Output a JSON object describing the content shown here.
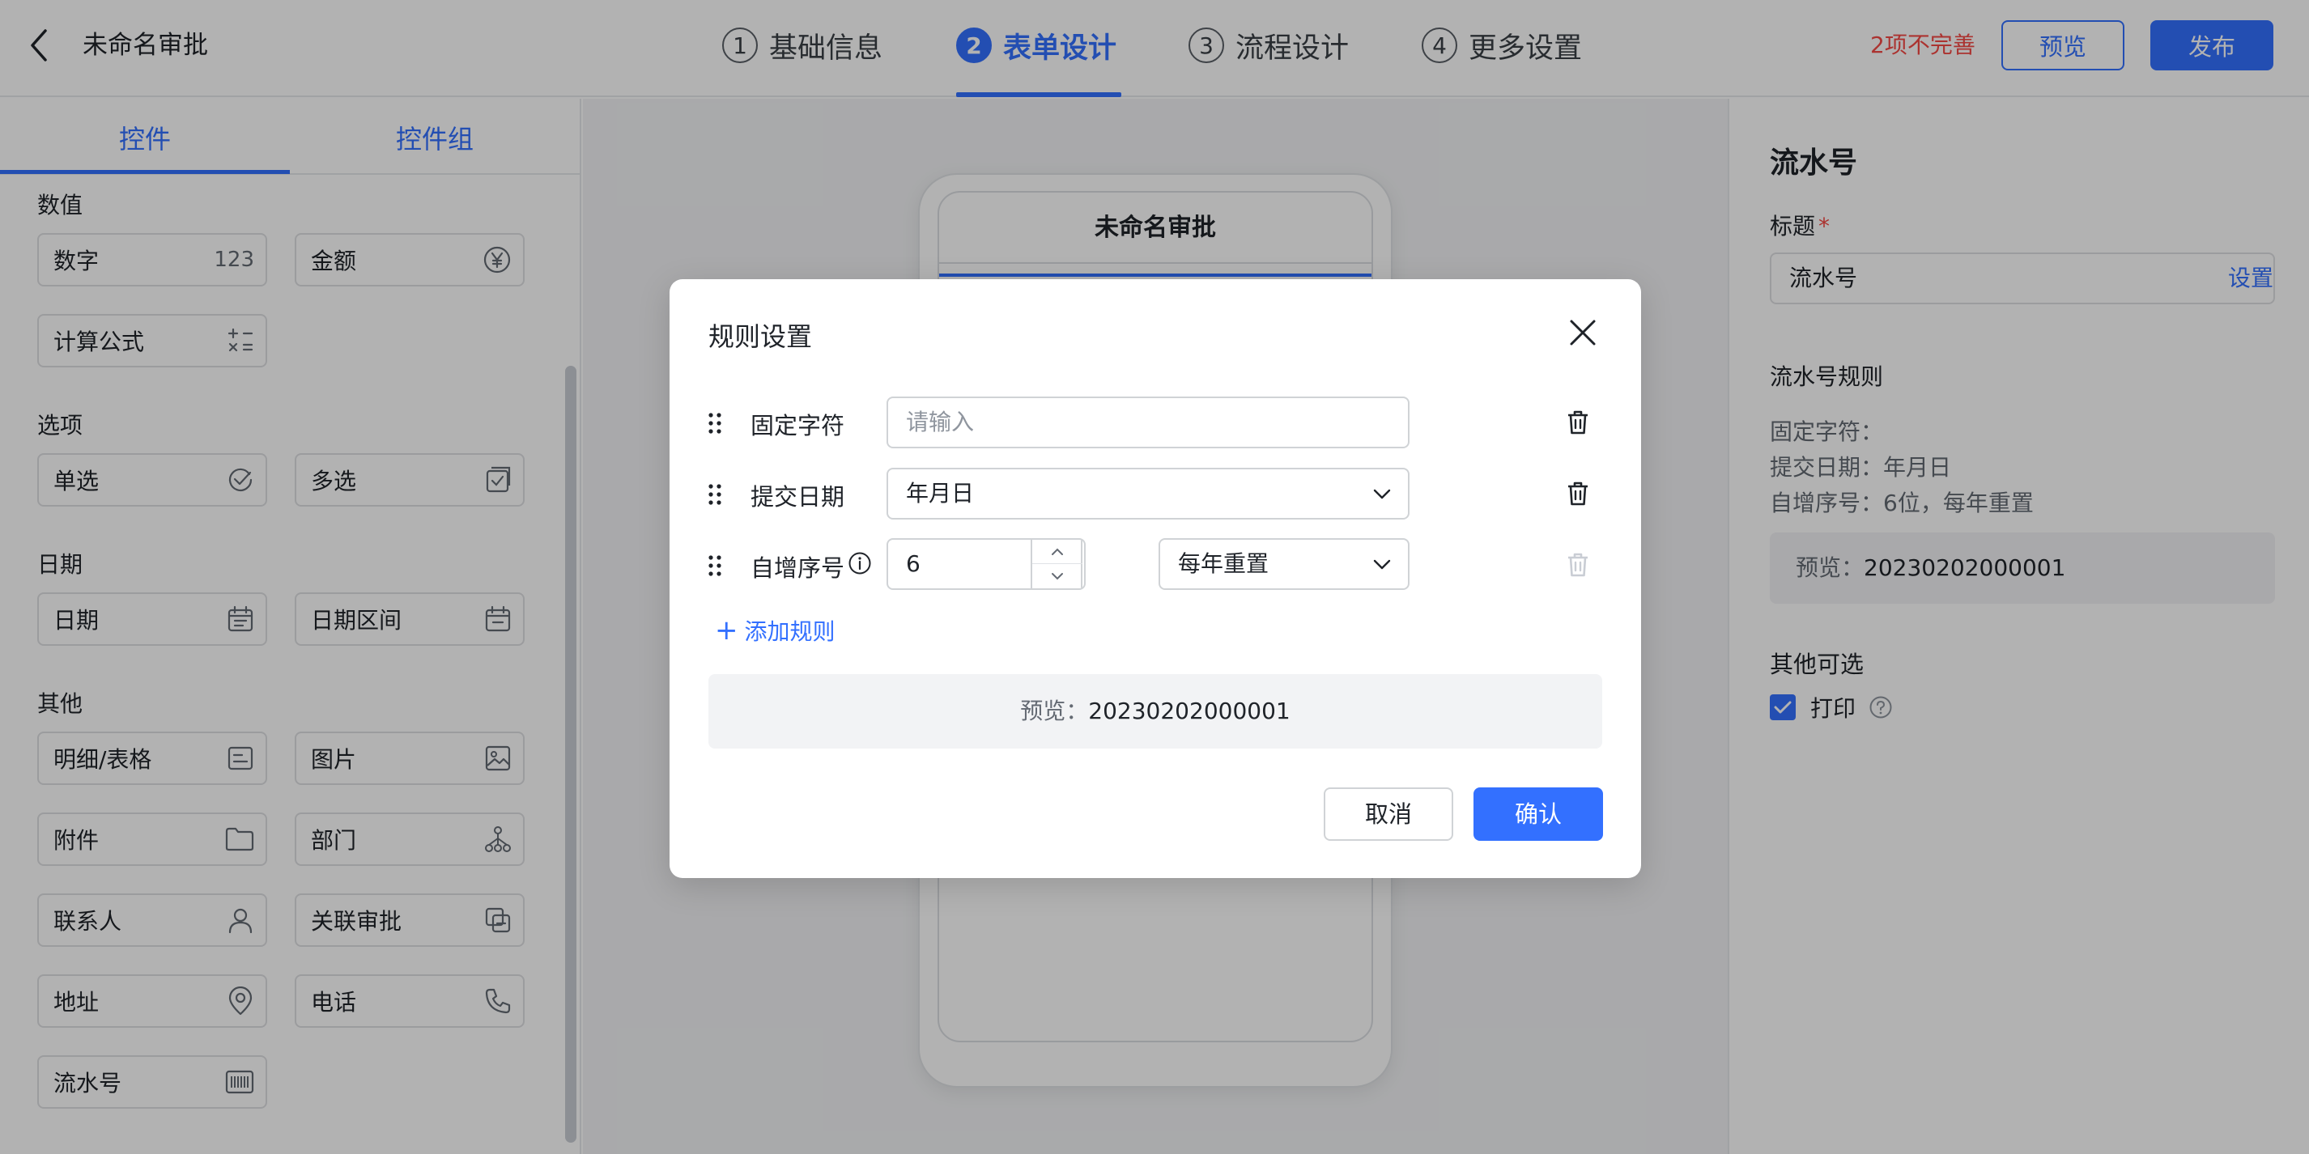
{
  "header": {
    "title": "未命名审批",
    "steps": [
      {
        "num": "1",
        "label": "基础信息"
      },
      {
        "num": "2",
        "label": "表单设计"
      },
      {
        "num": "3",
        "label": "流程设计"
      },
      {
        "num": "4",
        "label": "更多设置"
      }
    ],
    "active_step": 2,
    "incomplete_text": "2项不完善",
    "preview_label": "预览",
    "publish_label": "发布"
  },
  "left_panel": {
    "tabs": [
      "控件",
      "控件组"
    ],
    "sections": [
      {
        "title": "数值",
        "items": [
          {
            "label": "数字",
            "icon": "number-123-icon",
            "glyph": "123"
          },
          {
            "label": "金额",
            "icon": "currency-yen-icon"
          },
          {
            "label": "计算公式",
            "icon": "calculator-formula-icon"
          }
        ]
      },
      {
        "title": "选项",
        "items": [
          {
            "label": "单选",
            "icon": "radio-check-icon"
          },
          {
            "label": "多选",
            "icon": "checkbox-icon"
          }
        ]
      },
      {
        "title": "日期",
        "items": [
          {
            "label": "日期",
            "icon": "calendar-icon"
          },
          {
            "label": "日期区间",
            "icon": "calendar-range-icon"
          }
        ]
      },
      {
        "title": "其他",
        "items": [
          {
            "label": "明细/表格",
            "icon": "table-detail-icon"
          },
          {
            "label": "图片",
            "icon": "image-icon"
          },
          {
            "label": "附件",
            "icon": "folder-icon"
          },
          {
            "label": "部门",
            "icon": "org-tree-icon"
          },
          {
            "label": "联系人",
            "icon": "person-icon"
          },
          {
            "label": "关联审批",
            "icon": "link-approval-icon"
          },
          {
            "label": "地址",
            "icon": "location-pin-icon"
          },
          {
            "label": "电话",
            "icon": "phone-icon"
          },
          {
            "label": "流水号",
            "icon": "barcode-icon"
          }
        ]
      }
    ]
  },
  "canvas": {
    "phone_title": "未命名审批"
  },
  "right_panel": {
    "title": "流水号",
    "field_label": "标题",
    "required_mark": "*",
    "field_value": "流水号",
    "rule_title": "流水号规则",
    "rule_set_link": "设置",
    "rule_lines": [
      "固定字符：",
      "提交日期：年月日",
      "自增序号：6位，每年重置"
    ],
    "preview_label": "预览：",
    "preview_value": "20230202000001",
    "other_title": "其他可选",
    "print_label": "打印",
    "print_checked": true
  },
  "modal": {
    "title": "规则设置",
    "rows": [
      {
        "label": "固定字符",
        "placeholder": "请输入"
      },
      {
        "label": "提交日期",
        "select_value": "年月日"
      },
      {
        "label": "自增序号",
        "number_value": "6",
        "unit": "位",
        "select_value": "每年重置"
      }
    ],
    "add_rule_label": "添加规则",
    "preview_label": "预览：",
    "preview_value": "20230202000001",
    "cancel_label": "取消",
    "confirm_label": "确认"
  },
  "colors": {
    "accent": "#3370ff",
    "warning": "#f54a45",
    "text": "#1f2329",
    "muted": "#646a73"
  }
}
